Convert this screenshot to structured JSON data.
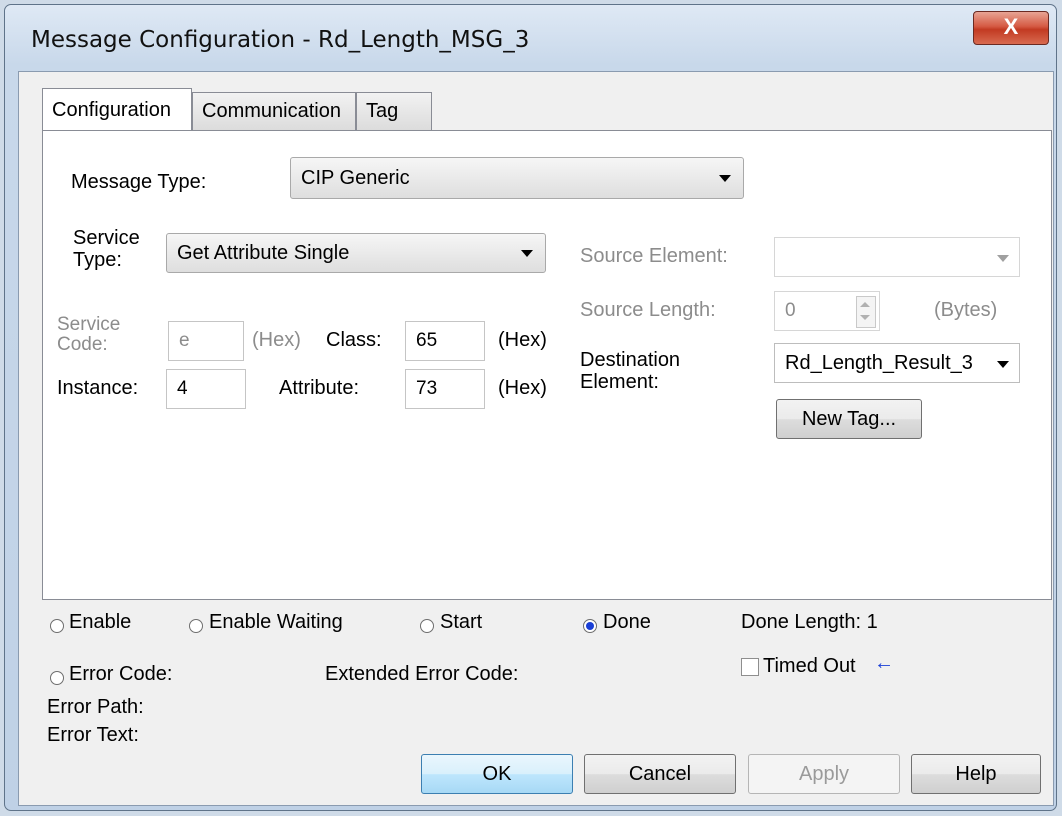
{
  "window": {
    "title": "Message Configuration - Rd_Length_MSG_3",
    "close_glyph": "X"
  },
  "tabs": [
    {
      "label": "Configuration",
      "active": true
    },
    {
      "label": "Communication",
      "active": false
    },
    {
      "label": "Tag",
      "active": false
    }
  ],
  "config": {
    "message_type_label": "Message Type:",
    "message_type_value": "CIP Generic",
    "service_type_label_1": "Service",
    "service_type_label_2": "Type:",
    "service_type_value": "Get Attribute Single",
    "service_code_label_1": "Service",
    "service_code_label_2": "Code:",
    "service_code_value": "e",
    "service_code_unit": "(Hex)",
    "class_label": "Class:",
    "class_value": "65",
    "class_unit": "(Hex)",
    "instance_label": "Instance:",
    "instance_value": "4",
    "attribute_label": "Attribute:",
    "attribute_value": "73",
    "attribute_unit": "(Hex)",
    "source_element_label": "Source Element:",
    "source_element_value": "",
    "source_length_label": "Source Length:",
    "source_length_value": "0",
    "source_length_unit": "(Bytes)",
    "destination_label_1": "Destination",
    "destination_label_2": "Element:",
    "destination_value": "Rd_Length_Result_3",
    "new_tag_label": "New Tag..."
  },
  "status": {
    "enable": "Enable",
    "enable_waiting": "Enable Waiting",
    "start": "Start",
    "done": "Done",
    "done_selected": true,
    "done_length": "Done Length: 1",
    "error_code": "Error Code:",
    "extended_error_code": "Extended Error Code:",
    "timed_out": "Timed Out",
    "timed_out_checked": false,
    "error_path": "Error Path:",
    "error_text": "Error Text:"
  },
  "buttons": {
    "ok": "OK",
    "cancel": "Cancel",
    "apply": "Apply",
    "help": "Help"
  },
  "colors": {
    "accent_radio": "#1a3fd6",
    "arrow_blue": "#1a3fd6"
  },
  "icons": [
    "close-icon",
    "dropdown-arrow-icon",
    "spin-arrows-icon",
    "radio-icon",
    "checkbox-icon",
    "arrow-left-icon"
  ]
}
